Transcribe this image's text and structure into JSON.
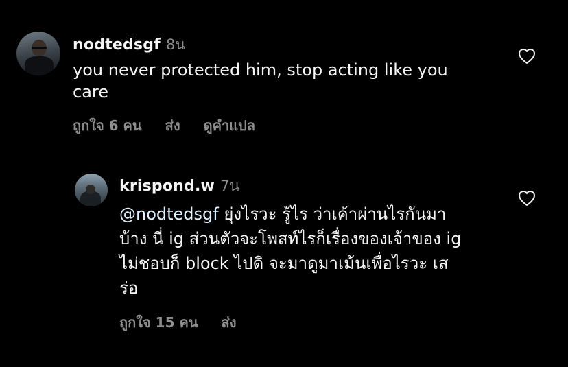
{
  "comments": [
    {
      "username": "nodtedsgf",
      "time": "8น",
      "text": "you never protected him, stop acting like you\ncare",
      "likes_label": "ถูกใจ 6 คน",
      "reply_label": "ส่ง",
      "translate_label": "ดูคำแปล"
    },
    {
      "username": "krispond.w",
      "time": "7น",
      "mention": "@nodtedsgf",
      "text": " ยุ่งไรวะ รู้ไร ว่าเค้าผ่านไรกันมา\nบ้าง นี่ ig ส่วนตัวจะโพสท์ไรก็เรื่องของเจ้าของ ig\nไม่ชอบก็ block ไปดิ จะมาดูมาเม้นเพื่อไรวะ เส\nร่อ",
      "likes_label": "ถูกใจ 15 คน",
      "reply_label": "ส่ง"
    }
  ],
  "icons": {
    "like": "heart-icon"
  },
  "colors": {
    "background": "#000000",
    "primary_text": "#f5f5f5",
    "secondary_text": "#8e8e8e"
  }
}
